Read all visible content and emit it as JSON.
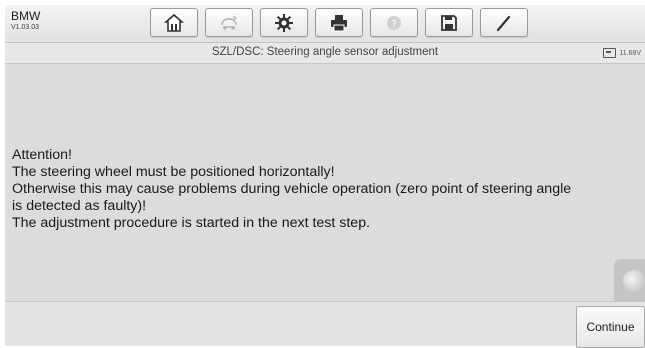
{
  "app": {
    "make": "BMW",
    "version": "V1.03.03"
  },
  "toolbar": {
    "buttons": [
      {
        "name": "home",
        "icon": "home-icon"
      },
      {
        "name": "vehicle-swap",
        "icon": "car-swap-icon"
      },
      {
        "name": "settings",
        "icon": "gear-icon"
      },
      {
        "name": "print",
        "icon": "printer-icon"
      },
      {
        "name": "help",
        "icon": "help-icon"
      },
      {
        "name": "save",
        "icon": "floppy-disk-icon"
      },
      {
        "name": "edit",
        "icon": "pen-icon"
      }
    ]
  },
  "header": {
    "title": "SZL/DSC: Steering angle sensor adjustment",
    "battery_voltage": "11.68V"
  },
  "message": {
    "lines": [
      "Attention!",
      "The steering wheel must be positioned horizontally!",
      "Otherwise this may cause problems during vehicle operation (zero point of steering angle",
      "is detected as faulty)!",
      "The adjustment procedure is started in the next test step."
    ]
  },
  "footer": {
    "continue_label": "Continue"
  }
}
